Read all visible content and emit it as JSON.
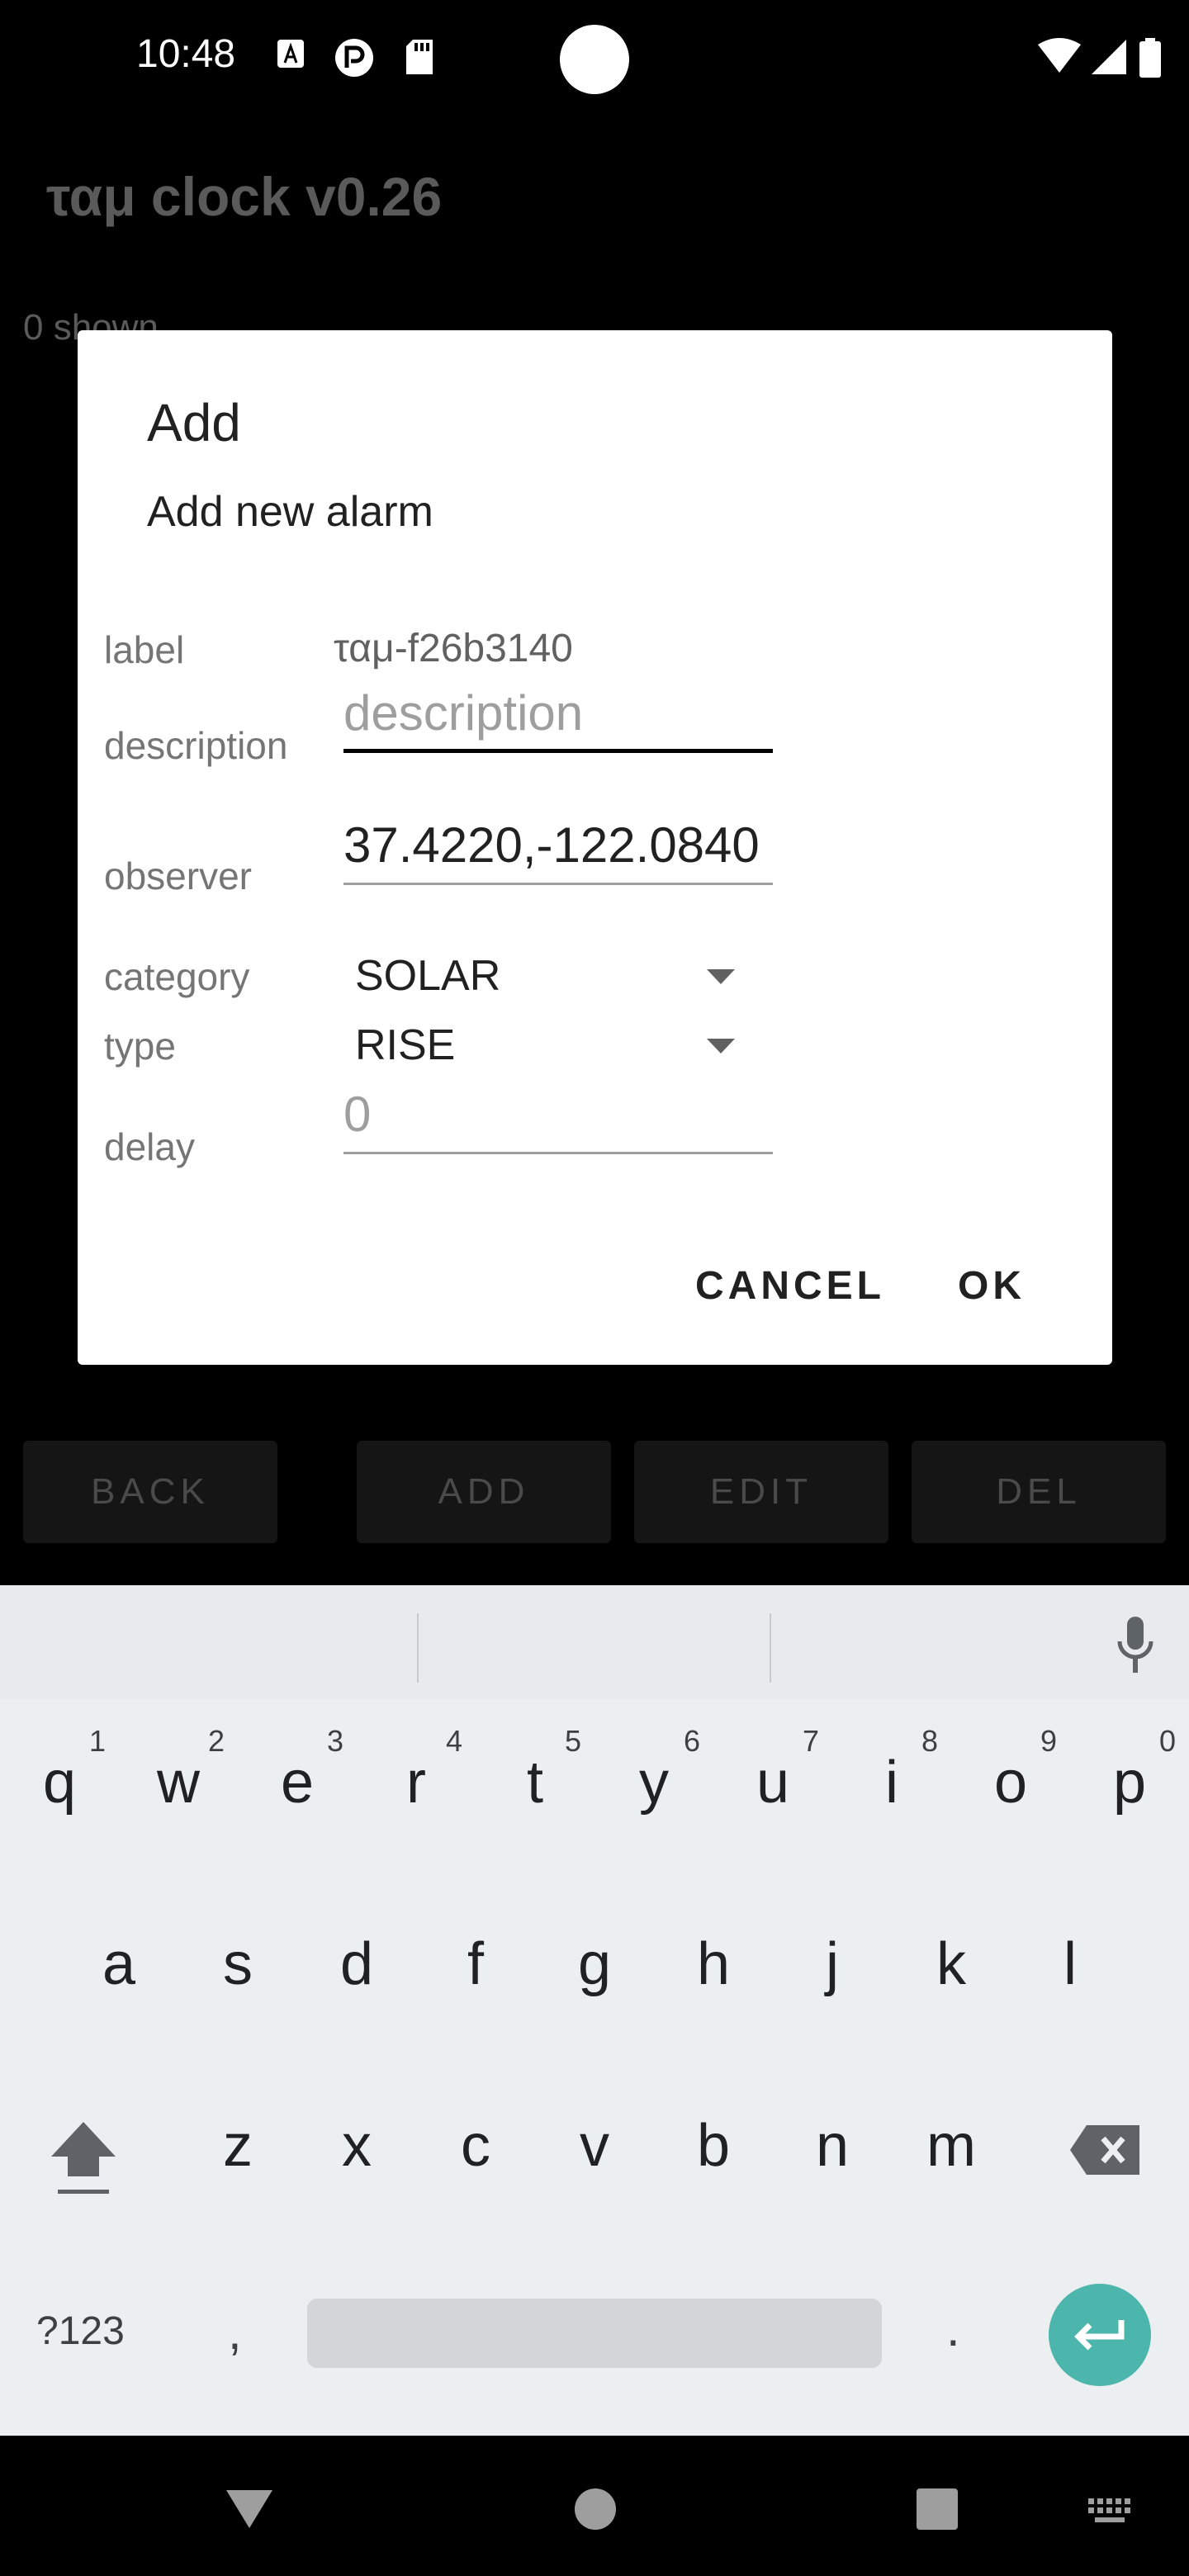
{
  "status_bar": {
    "time": "10:48"
  },
  "app": {
    "title": "ταμ clock v0.26",
    "shown_count": "0 shown",
    "buttons": {
      "back": "BACK",
      "add": "ADD",
      "edit": "EDIT",
      "del": "DEL"
    }
  },
  "dialog": {
    "title": "Add",
    "message": "Add new alarm",
    "fields": {
      "label": {
        "label": "label",
        "value": "ταμ-f26b3140"
      },
      "description": {
        "label": "description",
        "placeholder": "description"
      },
      "observer": {
        "label": "observer",
        "value": "37.4220,-122.0840"
      },
      "category": {
        "label": "category",
        "value": "SOLAR"
      },
      "type": {
        "label": "type",
        "value": "RISE"
      },
      "delay": {
        "label": "delay",
        "placeholder": "0"
      }
    },
    "buttons": {
      "cancel": "CANCEL",
      "ok": "OK"
    }
  },
  "keyboard": {
    "row1": [
      "q",
      "w",
      "e",
      "r",
      "t",
      "y",
      "u",
      "i",
      "o",
      "p"
    ],
    "row1_hints": [
      "1",
      "2",
      "3",
      "4",
      "5",
      "6",
      "7",
      "8",
      "9",
      "0"
    ],
    "row2": [
      "a",
      "s",
      "d",
      "f",
      "g",
      "h",
      "j",
      "k",
      "l"
    ],
    "row3": [
      "z",
      "x",
      "c",
      "v",
      "b",
      "n",
      "m"
    ],
    "symbols_key": "?123",
    "comma": ",",
    "period": ".",
    "accent_color": "#4db6ac"
  }
}
